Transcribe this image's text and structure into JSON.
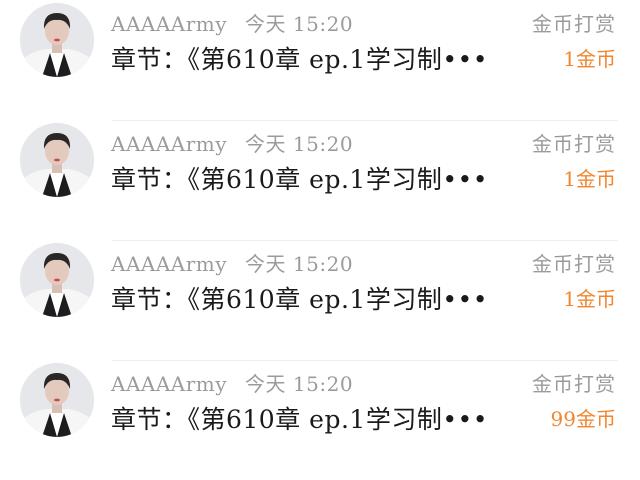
{
  "entries": [
    {
      "username": "AAAAArmy",
      "time": "今天 15:20",
      "title": "章节：《第610章 ep.1学习制•••",
      "tip_label": "金币打赏",
      "amount": "1金币"
    },
    {
      "username": "AAAAArmy",
      "time": "今天 15:20",
      "title": "章节：《第610章 ep.1学习制•••",
      "tip_label": "金币打赏",
      "amount": "1金币"
    },
    {
      "username": "AAAAArmy",
      "time": "今天 15:20",
      "title": "章节：《第610章 ep.1学习制•••",
      "tip_label": "金币打赏",
      "amount": "1金币"
    },
    {
      "username": "AAAAArmy",
      "time": "今天 15:20",
      "title": "章节：《第610章 ep.1学习制•••",
      "tip_label": "金币打赏",
      "amount": "99金币"
    }
  ],
  "colors": {
    "amount": "#f0862f",
    "meta": "#9b9b9b",
    "title": "#1a1a1a"
  },
  "icons": {
    "avatar": "user-avatar-photo"
  }
}
